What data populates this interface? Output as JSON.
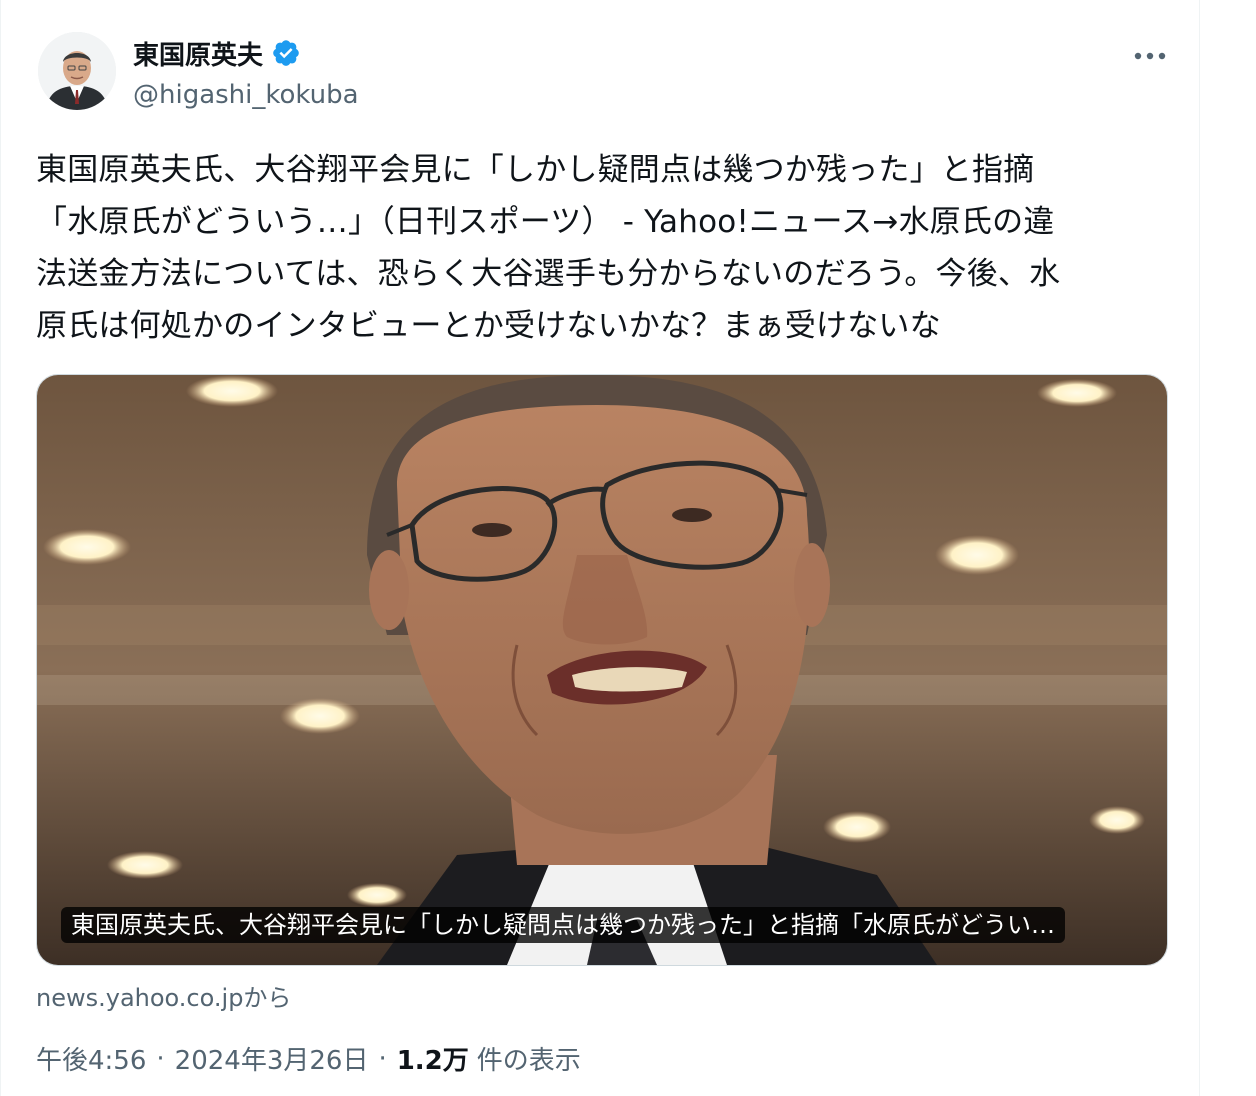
{
  "author": {
    "display_name": "東国原英夫",
    "handle": "@higashi_kokuba",
    "verified_color": "#1d9bf0"
  },
  "icons": {
    "verified": "verified-badge-icon",
    "more": "more-options-icon"
  },
  "tweet": {
    "text": "東国原英夫氏、大谷翔平会見に「しかし疑問点は幾つか残った」と指摘\n「水原氏がどういう…」（日刊スポーツ） - Yahoo!ニュース→水原氏の違\n法送金方法については、恐らく大谷選手も分からないのだろう。今後、水\n原氏は何処かのインタビューとか受けないかな？まぁ受けないな"
  },
  "card": {
    "title": "東国原英夫氏、大谷翔平会見に「しかし疑問点は幾つか残った」と指摘「水原氏がどうい…",
    "source": "news.yahoo.co.jpから"
  },
  "meta": {
    "time": "午後4:56",
    "separator_1": "·",
    "date": "2024年3月26日",
    "separator_2": "·",
    "views_count": "1.2万",
    "views_label": "件の表示"
  },
  "colors": {
    "text_primary": "#0f1419",
    "text_secondary": "#536471",
    "border": "#cfd9de",
    "accent": "#1d9bf0"
  }
}
